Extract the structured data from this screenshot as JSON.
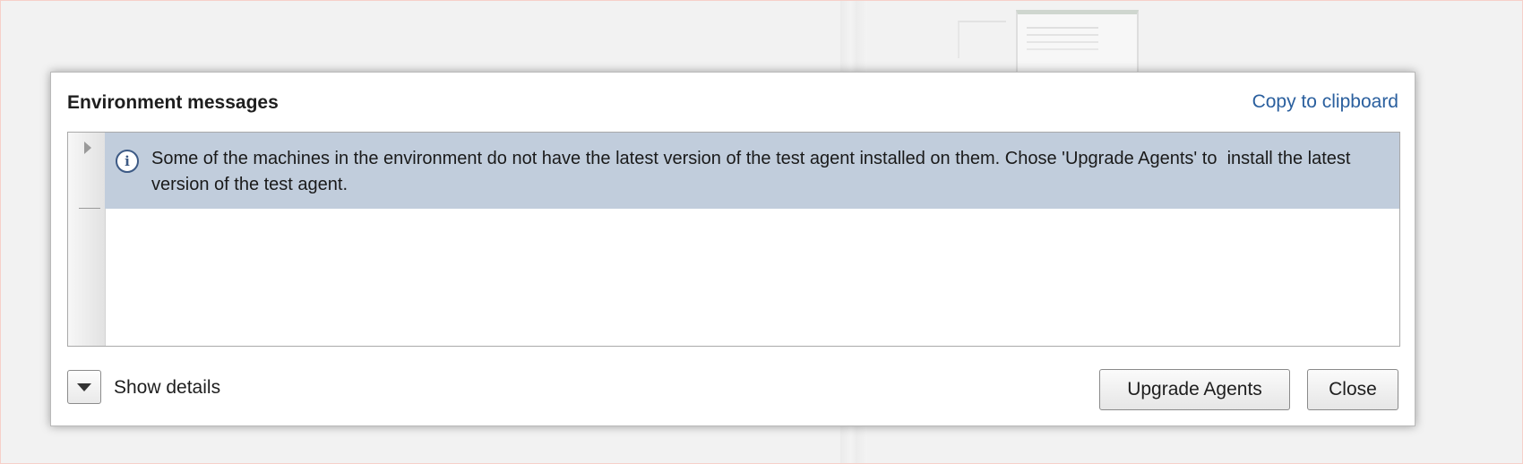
{
  "dialog": {
    "title": "Environment messages",
    "copy_link": "Copy to clipboard",
    "messages": [
      {
        "icon": "info-icon",
        "text": "Some of the machines in the environment do not have the latest version of the test agent installed on them. Chose 'Upgrade Agents' to  install the latest version of the test agent."
      }
    ],
    "footer": {
      "details_label": "Show details",
      "upgrade_button": "Upgrade Agents",
      "close_button": "Close"
    }
  },
  "colors": {
    "link": "#2a5f9e",
    "selected_row": "#c1cddc",
    "info_icon": "#3d5a85"
  }
}
